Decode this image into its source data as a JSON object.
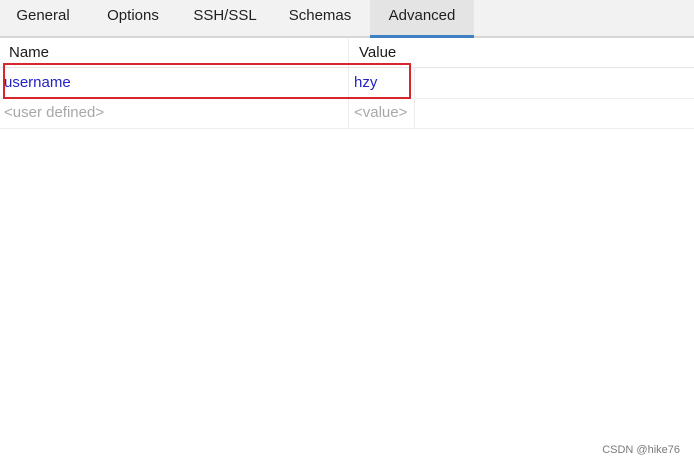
{
  "tabs": [
    {
      "label": "General"
    },
    {
      "label": "Options"
    },
    {
      "label": "SSH/SSL"
    },
    {
      "label": "Schemas"
    },
    {
      "label": "Advanced",
      "active": true
    }
  ],
  "table": {
    "columns": [
      "Name",
      "Value"
    ],
    "rows": [
      {
        "name": "username",
        "value": "hzy"
      },
      {
        "name": "<user defined>",
        "value": "<value>"
      }
    ]
  },
  "watermark": "CSDN @hike76",
  "colors": {
    "accent": "#3f7fc4",
    "highlight": "#d8262b",
    "link_text": "#2323c8",
    "placeholder": "#a8a8a8"
  }
}
